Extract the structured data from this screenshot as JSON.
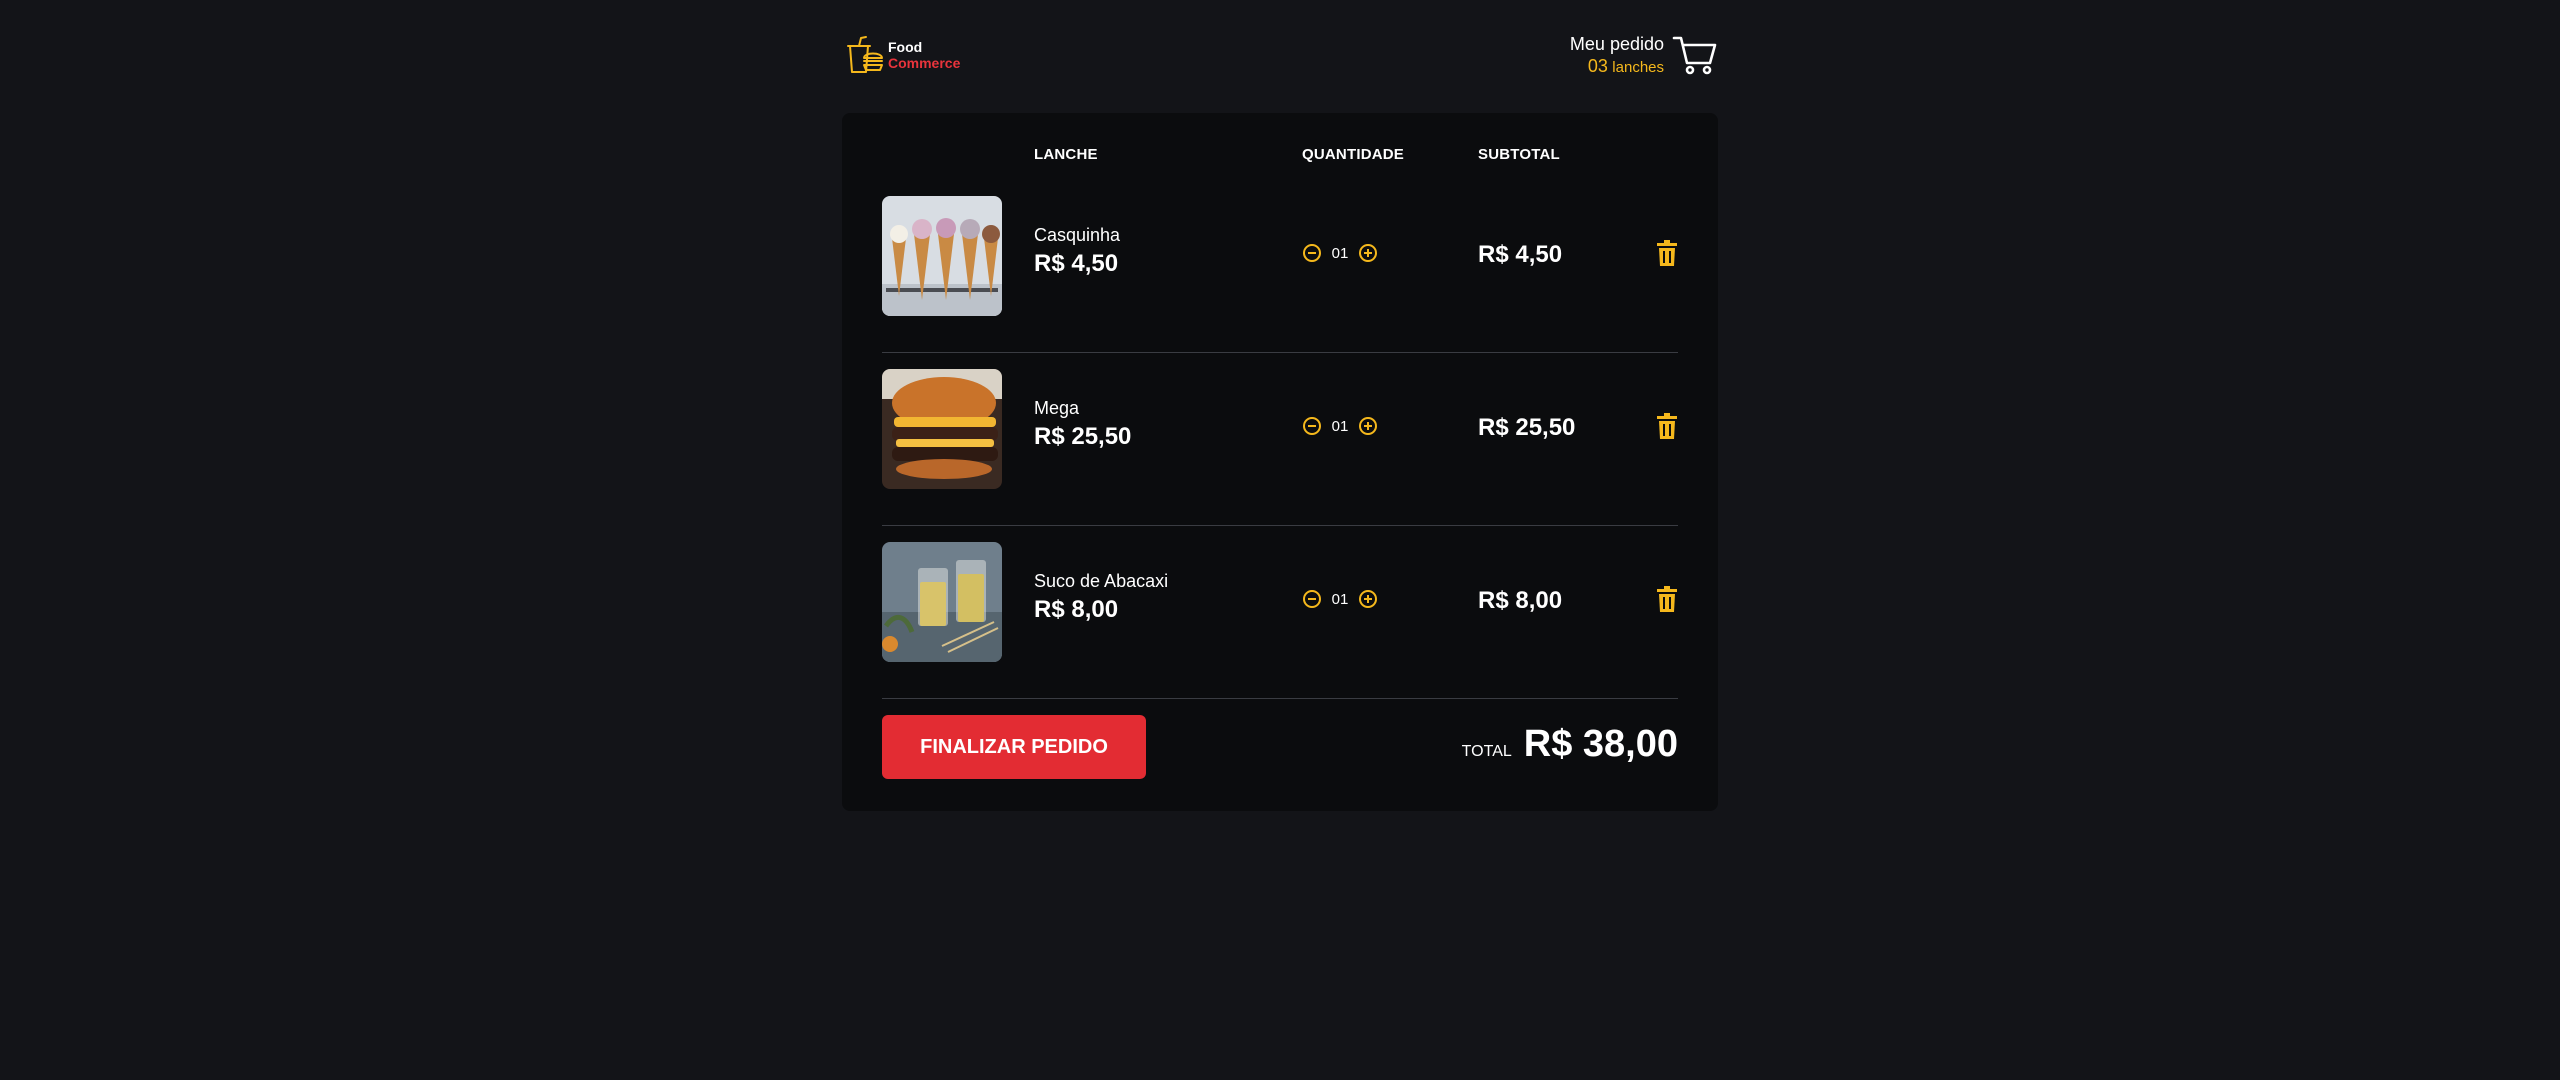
{
  "brand": {
    "name_line1": "Food",
    "name_line2": "Commerce"
  },
  "cart": {
    "title": "Meu pedido",
    "count": "03",
    "count_label": "lanches"
  },
  "table": {
    "headers": {
      "item": "LANCHE",
      "quantity": "QUANTIDADE",
      "subtotal": "SUBTOTAL"
    }
  },
  "items": [
    {
      "name": "Casquinha",
      "price": "R$ 4,50",
      "quantity": "01",
      "subtotal": "R$ 4,50",
      "image": "ice-cream-cones-photo"
    },
    {
      "name": "Mega",
      "price": "R$ 25,50",
      "quantity": "01",
      "subtotal": "R$ 25,50",
      "image": "burger-photo"
    },
    {
      "name": "Suco de Abacaxi",
      "price": "R$ 8,00",
      "quantity": "01",
      "subtotal": "R$ 8,00",
      "image": "pineapple-juice-photo"
    }
  ],
  "footer": {
    "finalize_label": "FINALIZAR PEDIDO",
    "total_label": "TOTAL",
    "total_value": "R$ 38,00"
  },
  "colors": {
    "accent": "#f5b81c",
    "brand_red": "#e32c33",
    "background": "#131418",
    "panel": "#0b0c0e"
  }
}
